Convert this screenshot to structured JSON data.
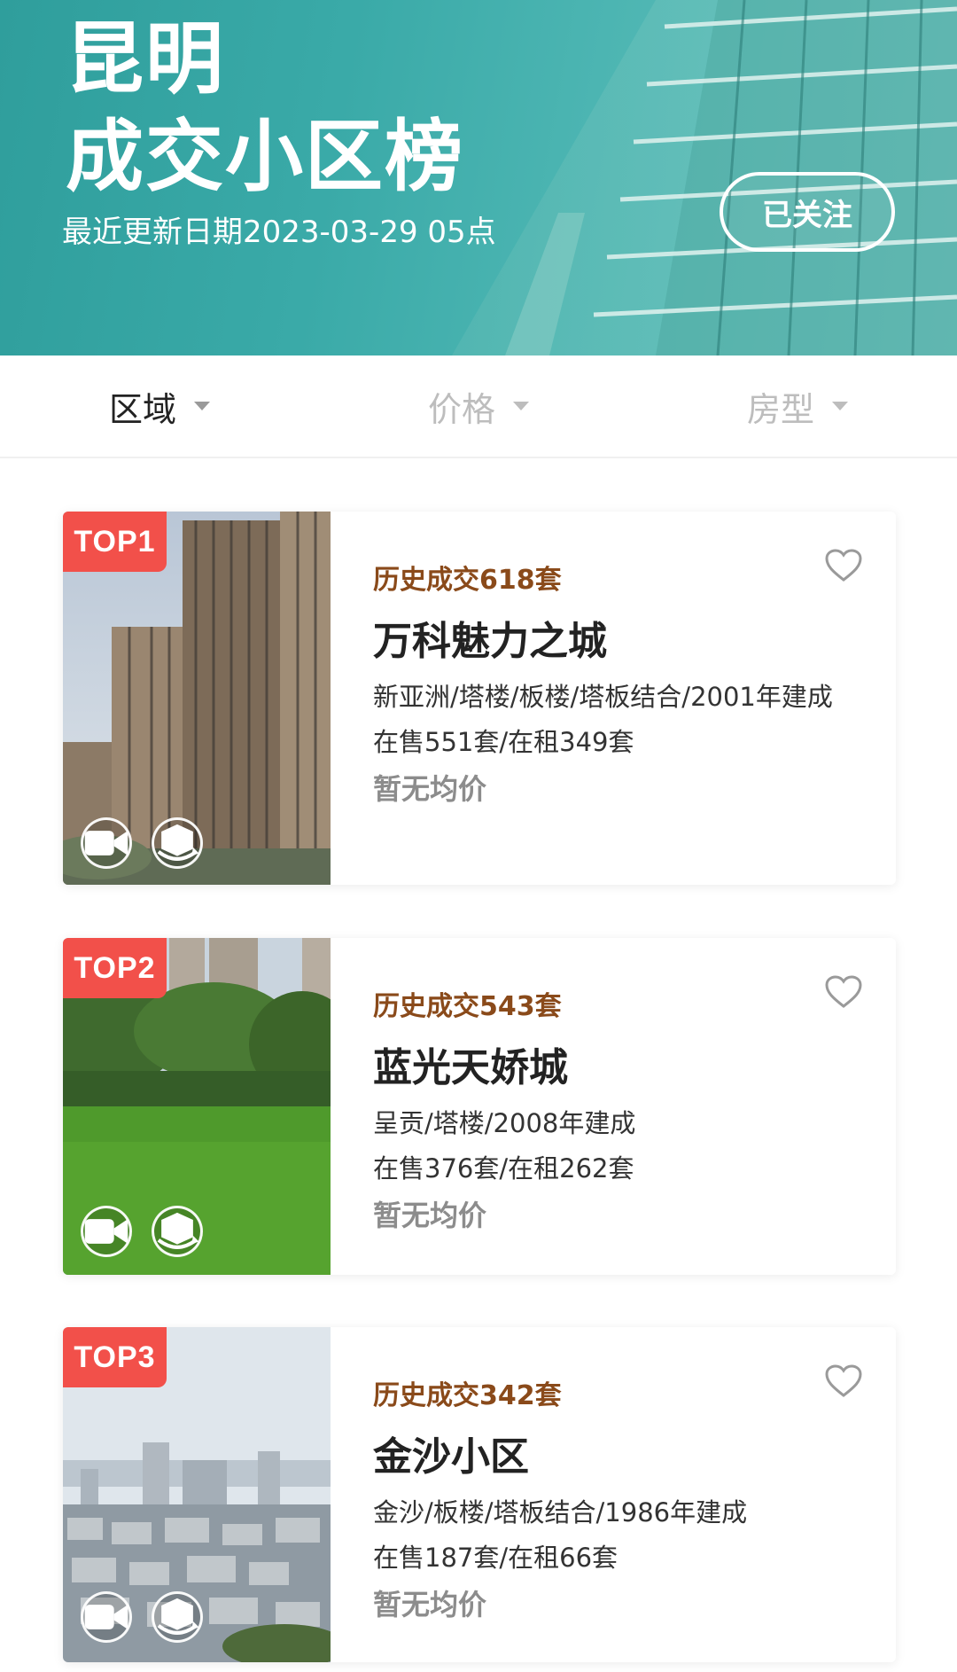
{
  "header": {
    "city": "昆明",
    "title": "成交小区榜",
    "update_text": "最近更新日期2023-03-29 05点",
    "follow_label": "已关注"
  },
  "filters": [
    {
      "label": "区域",
      "active": true
    },
    {
      "label": "价格",
      "active": false
    },
    {
      "label": "房型",
      "active": false
    }
  ],
  "colors": {
    "hero": "#3aaaa8",
    "badge": "#f2504a",
    "deal_text": "#8a4a1a",
    "price_text": "#8c8c8c"
  },
  "listings": [
    {
      "rank": "TOP1",
      "deal": "历史成交618套",
      "name": "万科魅力之城",
      "desc": "新亚洲/塔楼/板楼/塔板结合/2001年建成",
      "stock": "在售551套/在租349套",
      "price": "暂无均价",
      "icons": [
        "video-icon",
        "vr-3d-icon",
        "heart-outline-icon"
      ]
    },
    {
      "rank": "TOP2",
      "deal": "历史成交543套",
      "name": "蓝光天娇城",
      "desc": "呈贡/塔楼/2008年建成",
      "stock": "在售376套/在租262套",
      "price": "暂无均价",
      "icons": [
        "video-icon",
        "vr-3d-icon",
        "heart-outline-icon"
      ]
    },
    {
      "rank": "TOP3",
      "deal": "历史成交342套",
      "name": "金沙小区",
      "desc": "金沙/板楼/塔板结合/1986年建成",
      "stock": "在售187套/在租66套",
      "price": "暂无均价",
      "icons": [
        "video-icon",
        "vr-3d-icon",
        "heart-outline-icon"
      ]
    }
  ]
}
